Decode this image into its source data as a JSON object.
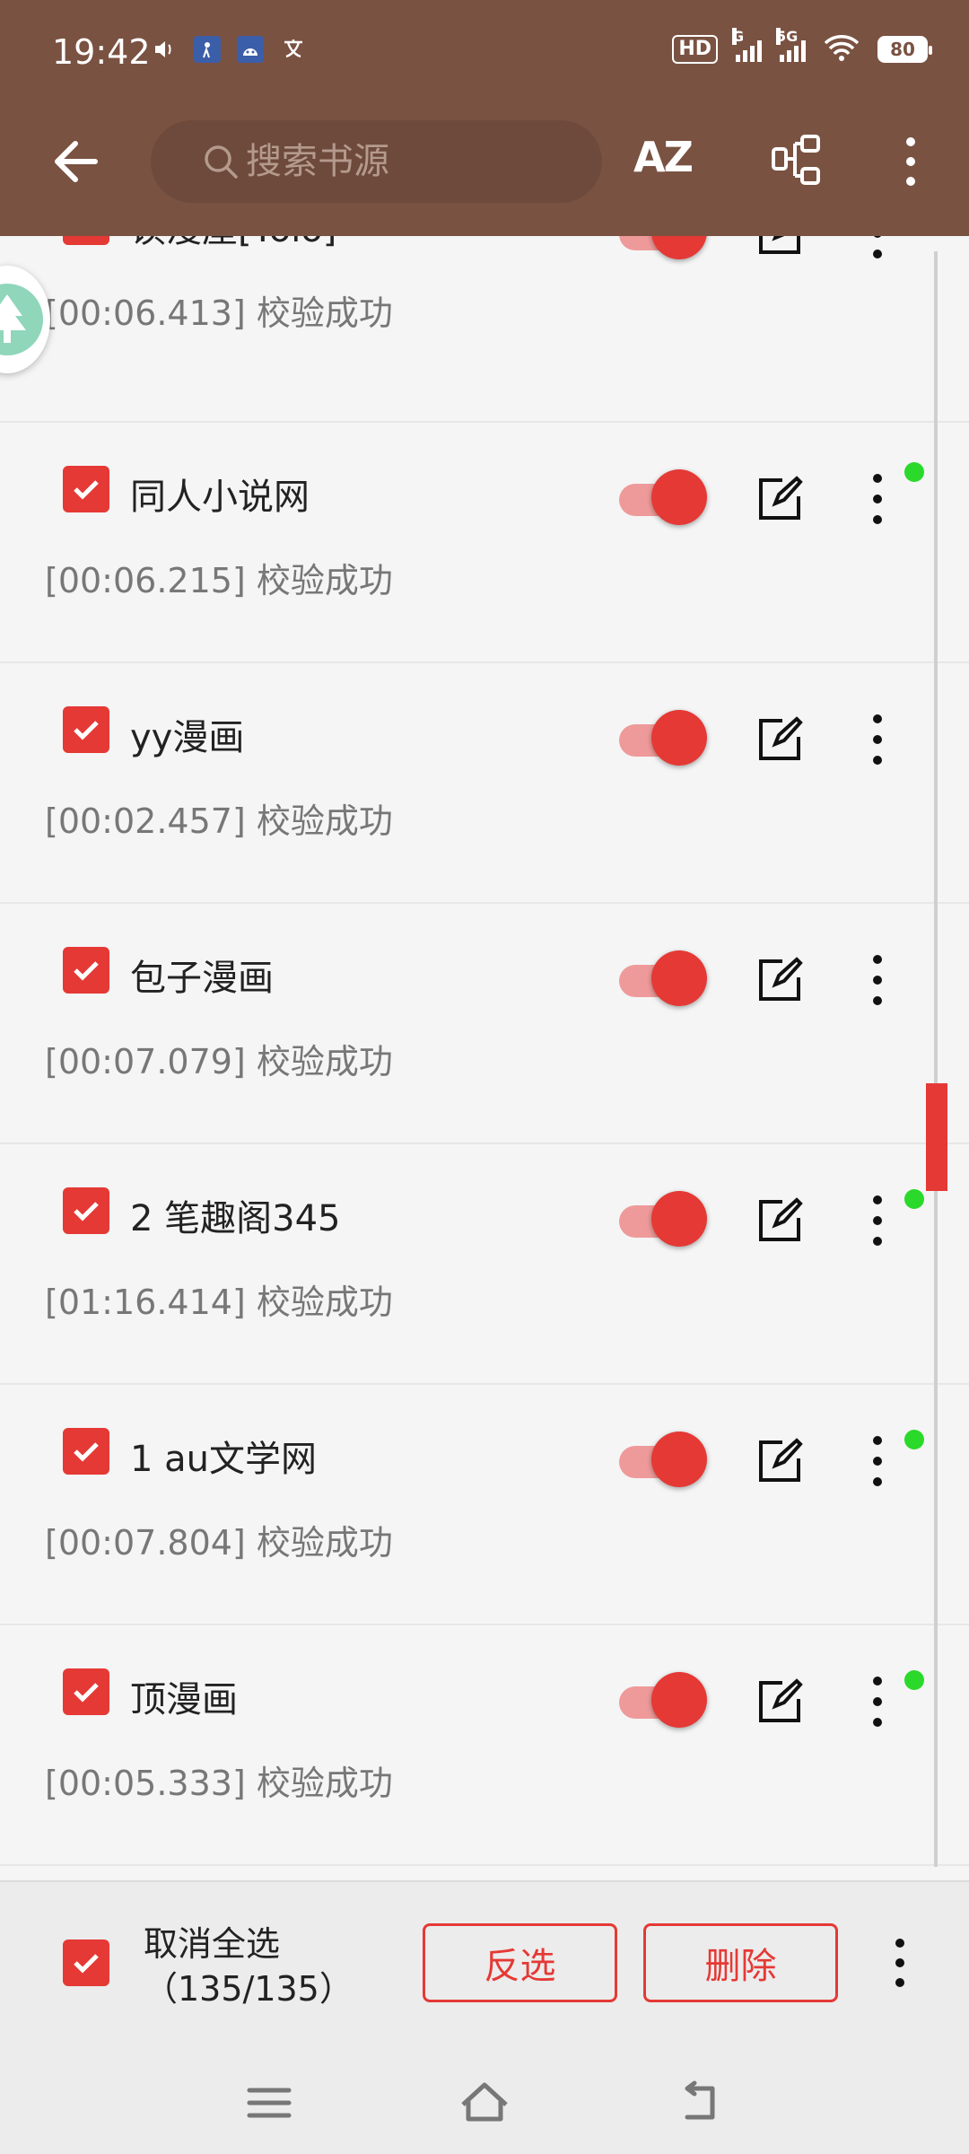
{
  "status_bar": {
    "time": "19:42",
    "left_icons": [
      "volume-icon",
      "app-notification-icon",
      "android-icon",
      "translate-icon"
    ],
    "hd_label": "HD",
    "signal_label_1": "G",
    "signal_label_2": "5G",
    "battery": "80"
  },
  "toolbar": {
    "search_placeholder": "搜索书源",
    "sort_label": "AZ",
    "icons": [
      "back-arrow-icon",
      "search-icon",
      "sort-az-icon",
      "group-icon",
      "more-vert-icon"
    ]
  },
  "sources": [
    {
      "title": "读漫屋[Yolo]",
      "status": "[00:06.413] 校验成功",
      "checked": true,
      "enabled": true,
      "indicator": true
    },
    {
      "title": "同人小说网",
      "status": "[00:06.215] 校验成功",
      "checked": true,
      "enabled": true,
      "indicator": true
    },
    {
      "title": "yy漫画",
      "status": "[00:02.457] 校验成功",
      "checked": true,
      "enabled": true,
      "indicator": false
    },
    {
      "title": "包子漫画",
      "status": "[00:07.079] 校验成功",
      "checked": true,
      "enabled": true,
      "indicator": false
    },
    {
      "title": "2 笔趣阁345",
      "status": "[01:16.414] 校验成功",
      "checked": true,
      "enabled": true,
      "indicator": true
    },
    {
      "title": "1 au文学网",
      "status": "[00:07.804] 校验成功",
      "checked": true,
      "enabled": true,
      "indicator": true
    },
    {
      "title": "顶漫画",
      "status": "[00:05.333] 校验成功",
      "checked": true,
      "enabled": true,
      "indicator": true
    }
  ],
  "bottom_bar": {
    "select_all_line1": "取消全选",
    "select_all_line2": "（135/135）",
    "invert_label": "反选",
    "delete_label": "删除"
  },
  "colors": {
    "appbar": "#7a5242",
    "accent": "#e53935",
    "indicator": "#2bd92b"
  }
}
